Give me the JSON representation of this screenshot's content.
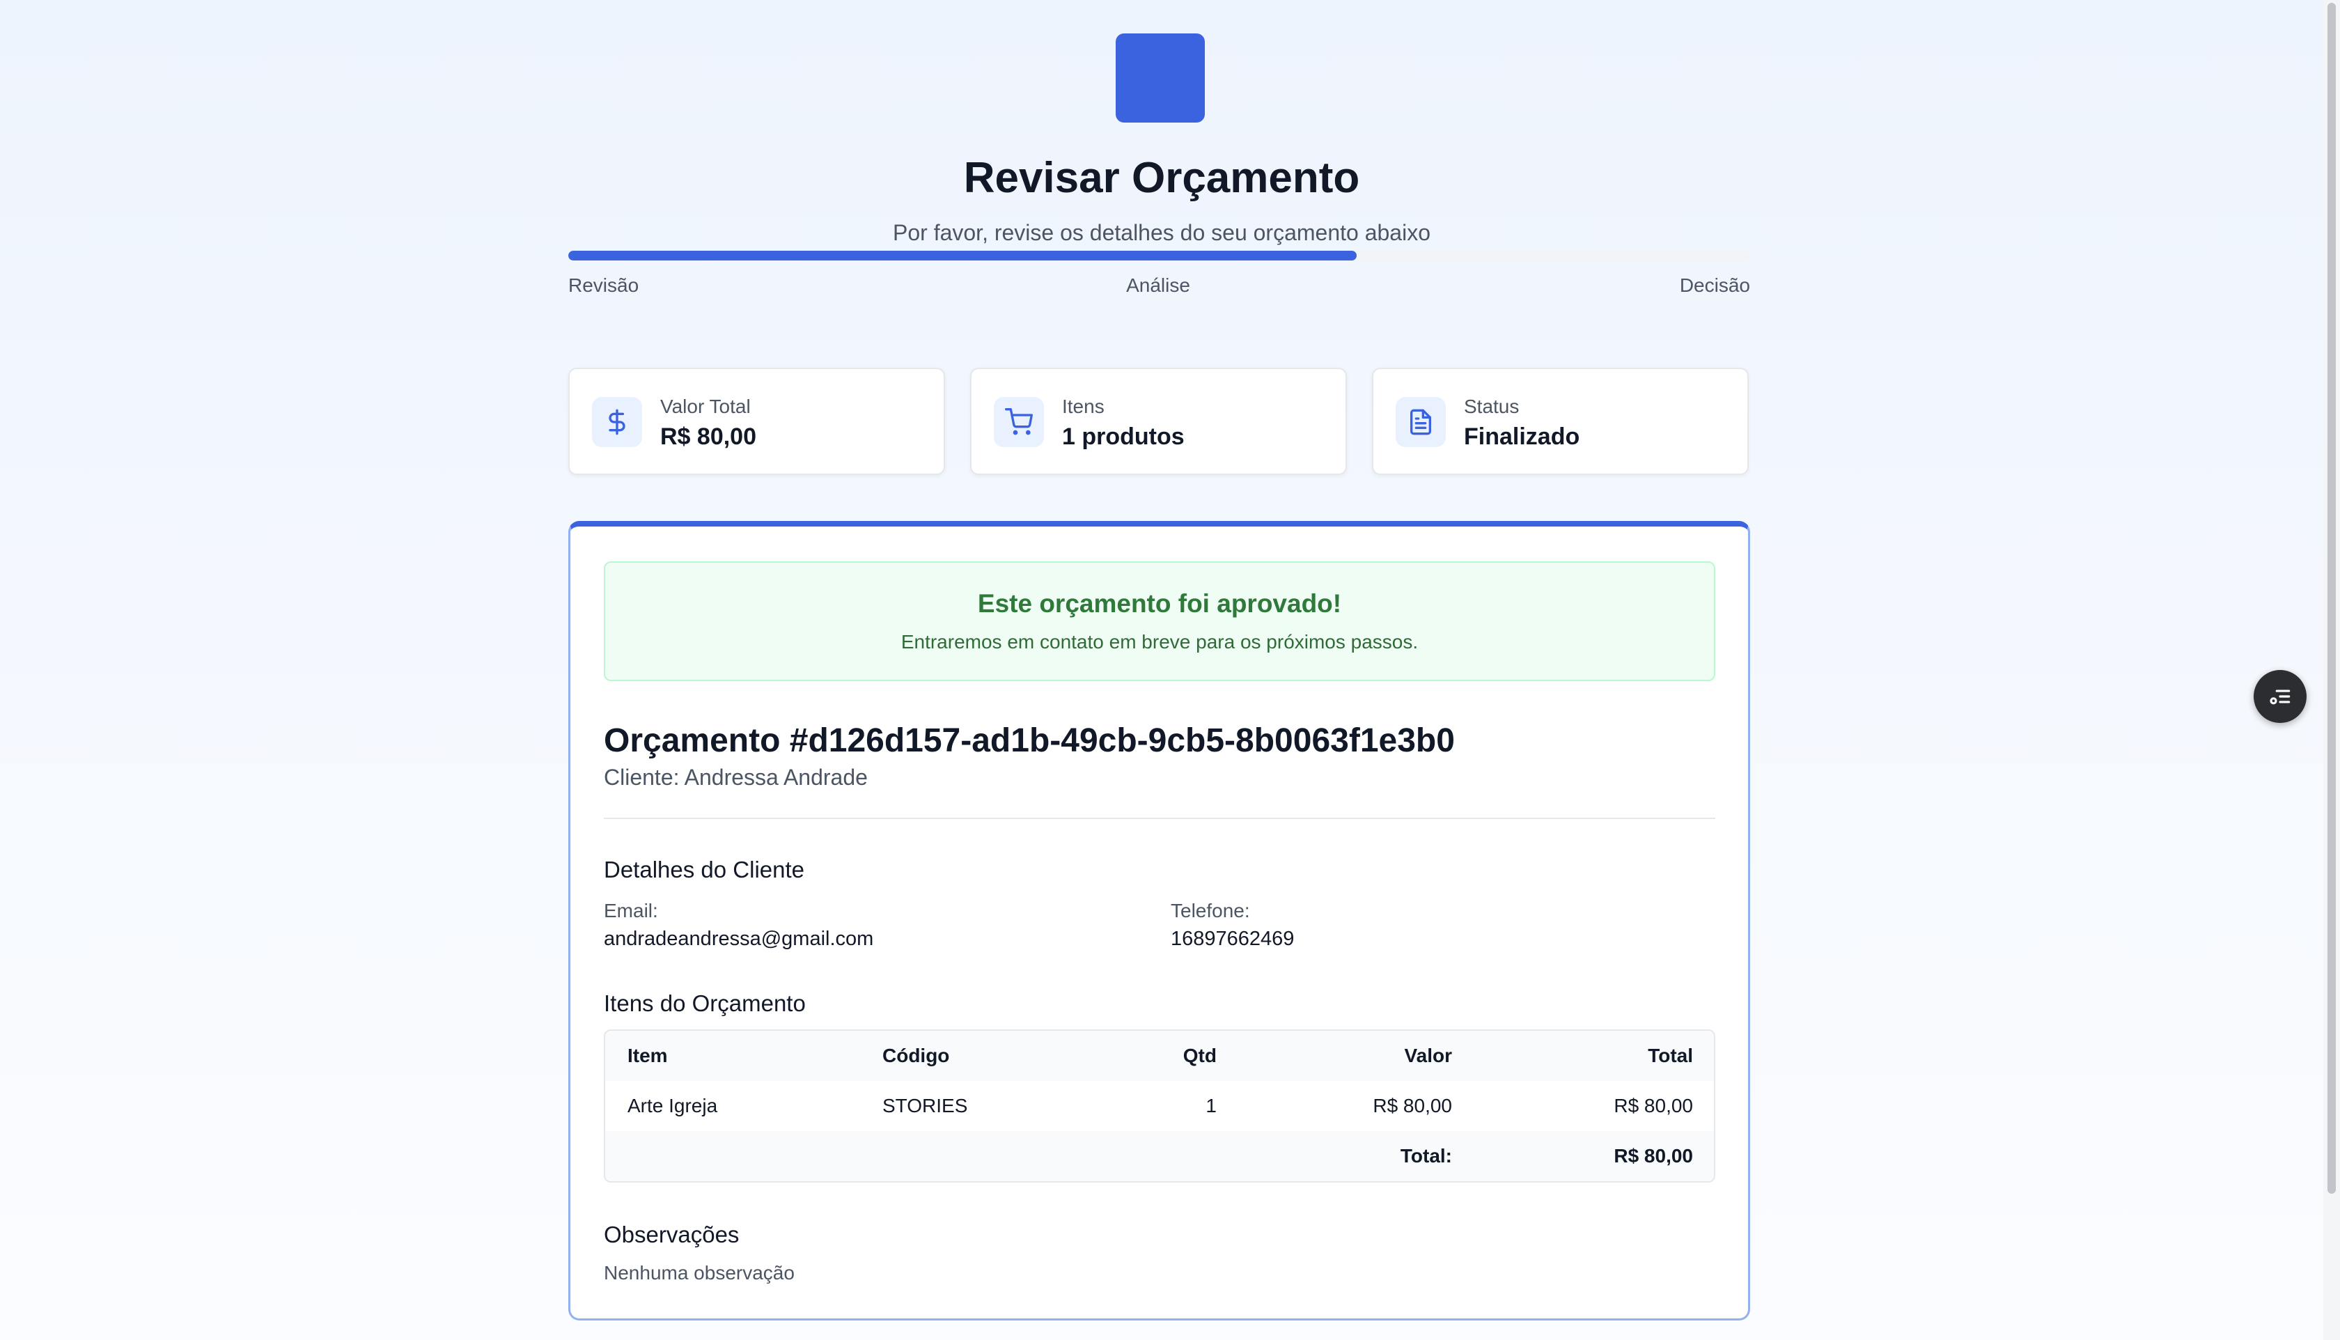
{
  "header": {
    "title": "Revisar Orçamento",
    "subtitle": "Por favor, revise os detalhes do seu orçamento abaixo"
  },
  "progress": {
    "value": 0.667,
    "steps": [
      "Revisão",
      "Análise",
      "Decisão"
    ]
  },
  "summary": {
    "total_label": "Valor Total",
    "total_value": "R$ 80,00",
    "items_label": "Itens",
    "items_value": "1 produtos",
    "status_label": "Status",
    "status_value": "Finalizado"
  },
  "alert": {
    "title": "Este orçamento foi aprovado!",
    "text": "Entraremos em contato em breve para os próximos passos."
  },
  "quote": {
    "title": "Orçamento #d126d157-ad1b-49cb-9cb5-8b0063f1e3b0",
    "client": "Cliente: Andressa Andrade"
  },
  "client_details": {
    "heading": "Detalhes do Cliente",
    "email_label": "Email:",
    "email": "andradeandressa@gmail.com",
    "phone_label": "Telefone:",
    "phone": "16897662469"
  },
  "items": {
    "heading": "Itens do Orçamento",
    "columns": [
      "Item",
      "Código",
      "Qtd",
      "Valor",
      "Total"
    ],
    "rows": [
      [
        "Arte Igreja",
        "STORIES",
        "1",
        "R$ 80,00",
        "R$ 80,00"
      ]
    ],
    "total_label": "Total:",
    "total_value": "R$ 80,00"
  },
  "notes": {
    "heading": "Observações",
    "text": "Nenhuma observação"
  },
  "colors": {
    "accent": "#3b63e0",
    "success_bg": "#f0fdf4",
    "success_text": "#2f7a3b"
  },
  "icons": {
    "total": "dollar-icon",
    "items": "cart-icon",
    "status": "document-icon",
    "fab": "checklist-icon"
  }
}
